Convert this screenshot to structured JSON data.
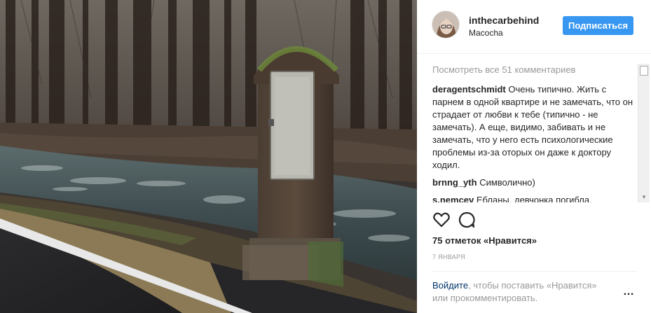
{
  "post": {
    "username": "inthecarbehind",
    "location": "Macocha",
    "follow_label": "Подписаться",
    "view_all_comments": "Посмотреть все 51 комментариев",
    "comments": [
      {
        "author": "deragentschmidt",
        "text": "Очень типично. Жить с парнем в одной квартире и не замечать, что он страдает от любви к тебе (типично - не замечать). А еще, видимо, забивать и не замечать, что у него есть психологические проблемы из-за оторых он даже к доктору ходил."
      },
      {
        "author": "brnng_yth",
        "text": "Символично)"
      },
      {
        "author": "s.nemcev",
        "text": "Ебланы, девчонка погибла,"
      }
    ],
    "likes": "75 отметок «Нравится»",
    "date": "7 января",
    "login_link": "Войдите",
    "login_text": ", чтобы поставить «Нравится» или прокомментировать.",
    "more_label": "…"
  },
  "icons": {
    "like": "heart-icon",
    "comment": "comment-bubble-icon",
    "more": "ellipsis-icon",
    "scroll_up": "scroll-up-arrow-icon",
    "scroll_down": "scroll-down-arrow-icon"
  },
  "colors": {
    "follow_button": "#3897f0",
    "link": "#003569",
    "muted_text": "#999999",
    "text": "#262626"
  }
}
